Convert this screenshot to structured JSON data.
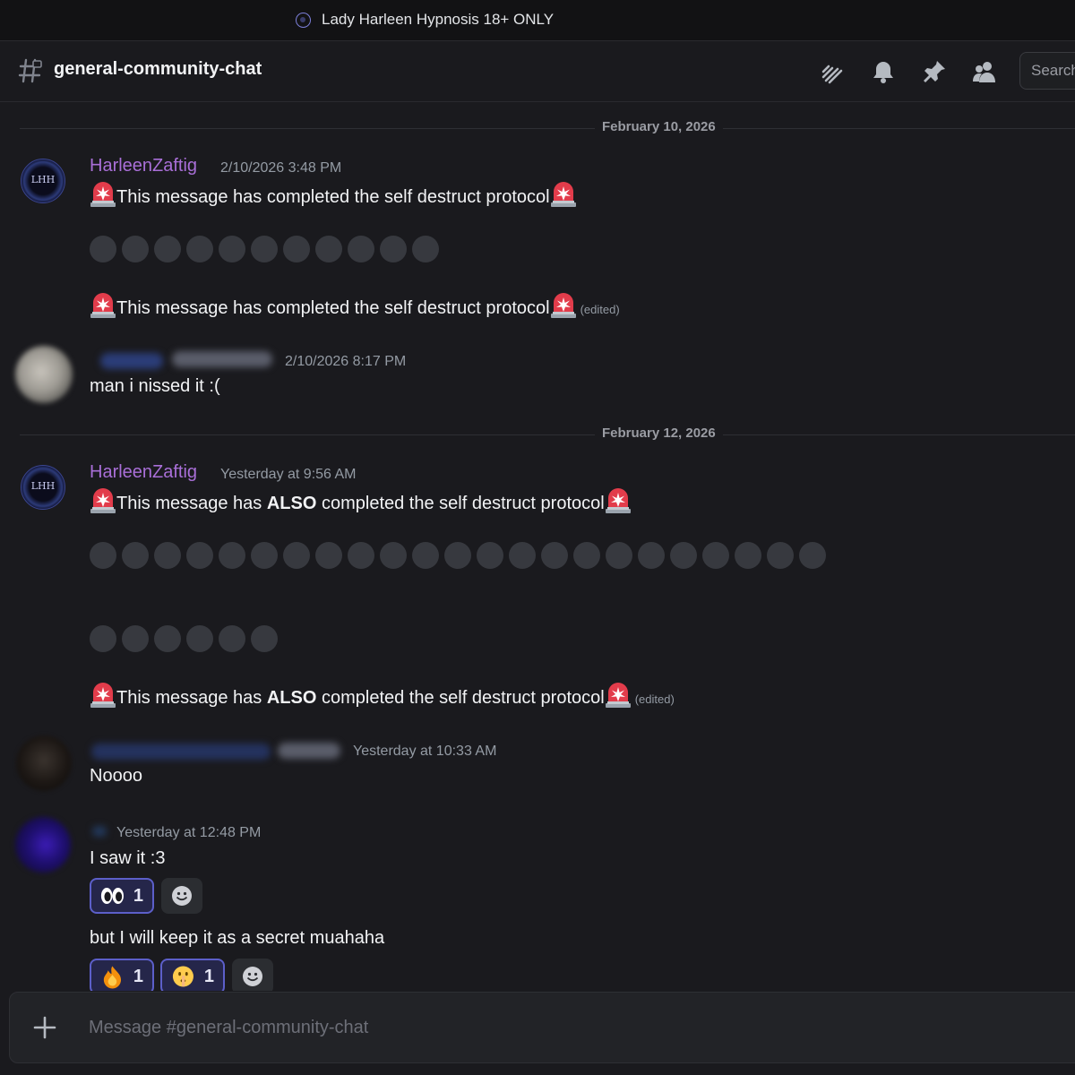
{
  "window": {
    "server_title": "Lady Harleen Hypnosis 18+ ONLY"
  },
  "header": {
    "channel_name": "general-community-chat",
    "search_placeholder": "Search"
  },
  "dividers": [
    "February 10, 2026",
    "February 12, 2026"
  ],
  "messages": [
    {
      "author": "HarleenZaftig",
      "timestamp": "2/10/2026 3:48 PM",
      "lines": [
        {
          "text": "This message has completed the self destruct protocol",
          "edited": ""
        },
        {
          "spoiler_dots": 11
        },
        {
          "text": "This message has completed the self destruct protocol",
          "edited": "(edited)"
        }
      ]
    },
    {
      "author": "",
      "timestamp": "2/10/2026 8:17 PM",
      "text": "man i nissed it :("
    },
    {
      "author": "HarleenZaftig",
      "timestamp": "Yesterday at 9:56 AM",
      "lines": [
        {
          "pre": "This message has ",
          "bold": "ALSO",
          "post": " completed the self destruct protocol"
        },
        {
          "spoiler_dots": 23
        },
        {
          "spoiler_dots": 6
        },
        {
          "pre": "This message has ",
          "bold": "ALSO",
          "post": " completed the self destruct protocol",
          "edited": "(edited)"
        }
      ]
    },
    {
      "author": "",
      "timestamp": "Yesterday at 10:33 AM",
      "text": "Noooo"
    },
    {
      "author": "",
      "timestamp": "Yesterday at 12:48 PM",
      "text": "I saw it :3",
      "reactions": [
        {
          "emoji": "eyes",
          "count": "1"
        }
      ],
      "text2": "but I will keep it as a secret muahaha",
      "reactions2": [
        {
          "emoji": "fire",
          "count": "1"
        },
        {
          "emoji": "shushing-face",
          "count": "1"
        }
      ]
    }
  ],
  "composer": {
    "placeholder": "Message #general-community-chat"
  },
  "avatar_text": "LHH",
  "colors": {
    "accent_username": "#a96fd8",
    "reaction_border": "#5c5fc9",
    "background": "#1a1a1e"
  }
}
